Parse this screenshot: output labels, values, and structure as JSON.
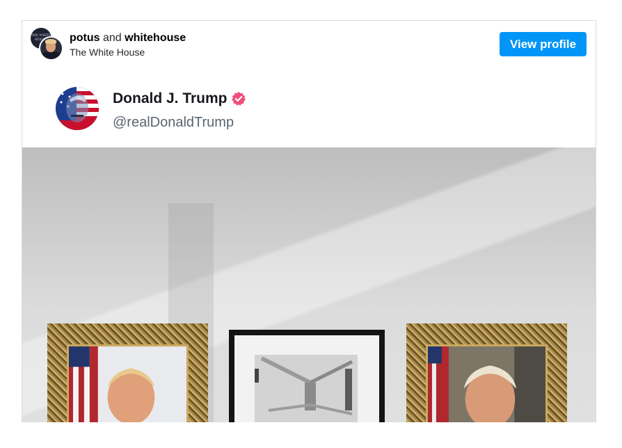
{
  "post_header": {
    "user1": "potus",
    "connector": "and",
    "user2": "whitehouse",
    "subtitle": "The White House",
    "view_profile_label": "View profile",
    "avatar1_text": "THE WHITE HOUSE"
  },
  "tweet": {
    "display_name": "Donald J. Trump",
    "handle": "@realDonaldTrump",
    "verified_icon": "verified-badge-icon",
    "badge_color": "#f04e7a"
  },
  "colors": {
    "accent": "#0095f6"
  }
}
